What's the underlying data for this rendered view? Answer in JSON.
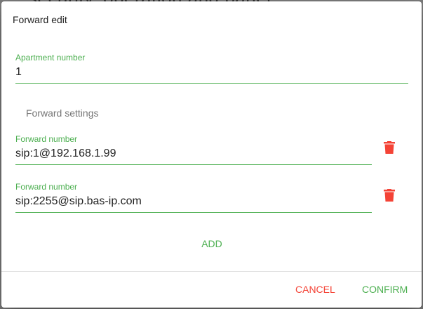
{
  "background": {
    "text": "security, operation and panel"
  },
  "dialog": {
    "title": "Forward edit",
    "apartment": {
      "label": "Apartment number",
      "value": "1"
    },
    "section_title": "Forward settings",
    "forwards": [
      {
        "label": "Forward number",
        "value": "sip:1@192.168.1.99",
        "delete_icon": "trash-icon"
      },
      {
        "label": "Forward number",
        "value": "sip:2255@sip.bas-ip.com",
        "delete_icon": "trash-icon"
      }
    ],
    "add_label": "ADD",
    "cancel_label": "CANCEL",
    "confirm_label": "CONFIRM"
  },
  "colors": {
    "accent": "#4caf50",
    "danger": "#f44336"
  }
}
